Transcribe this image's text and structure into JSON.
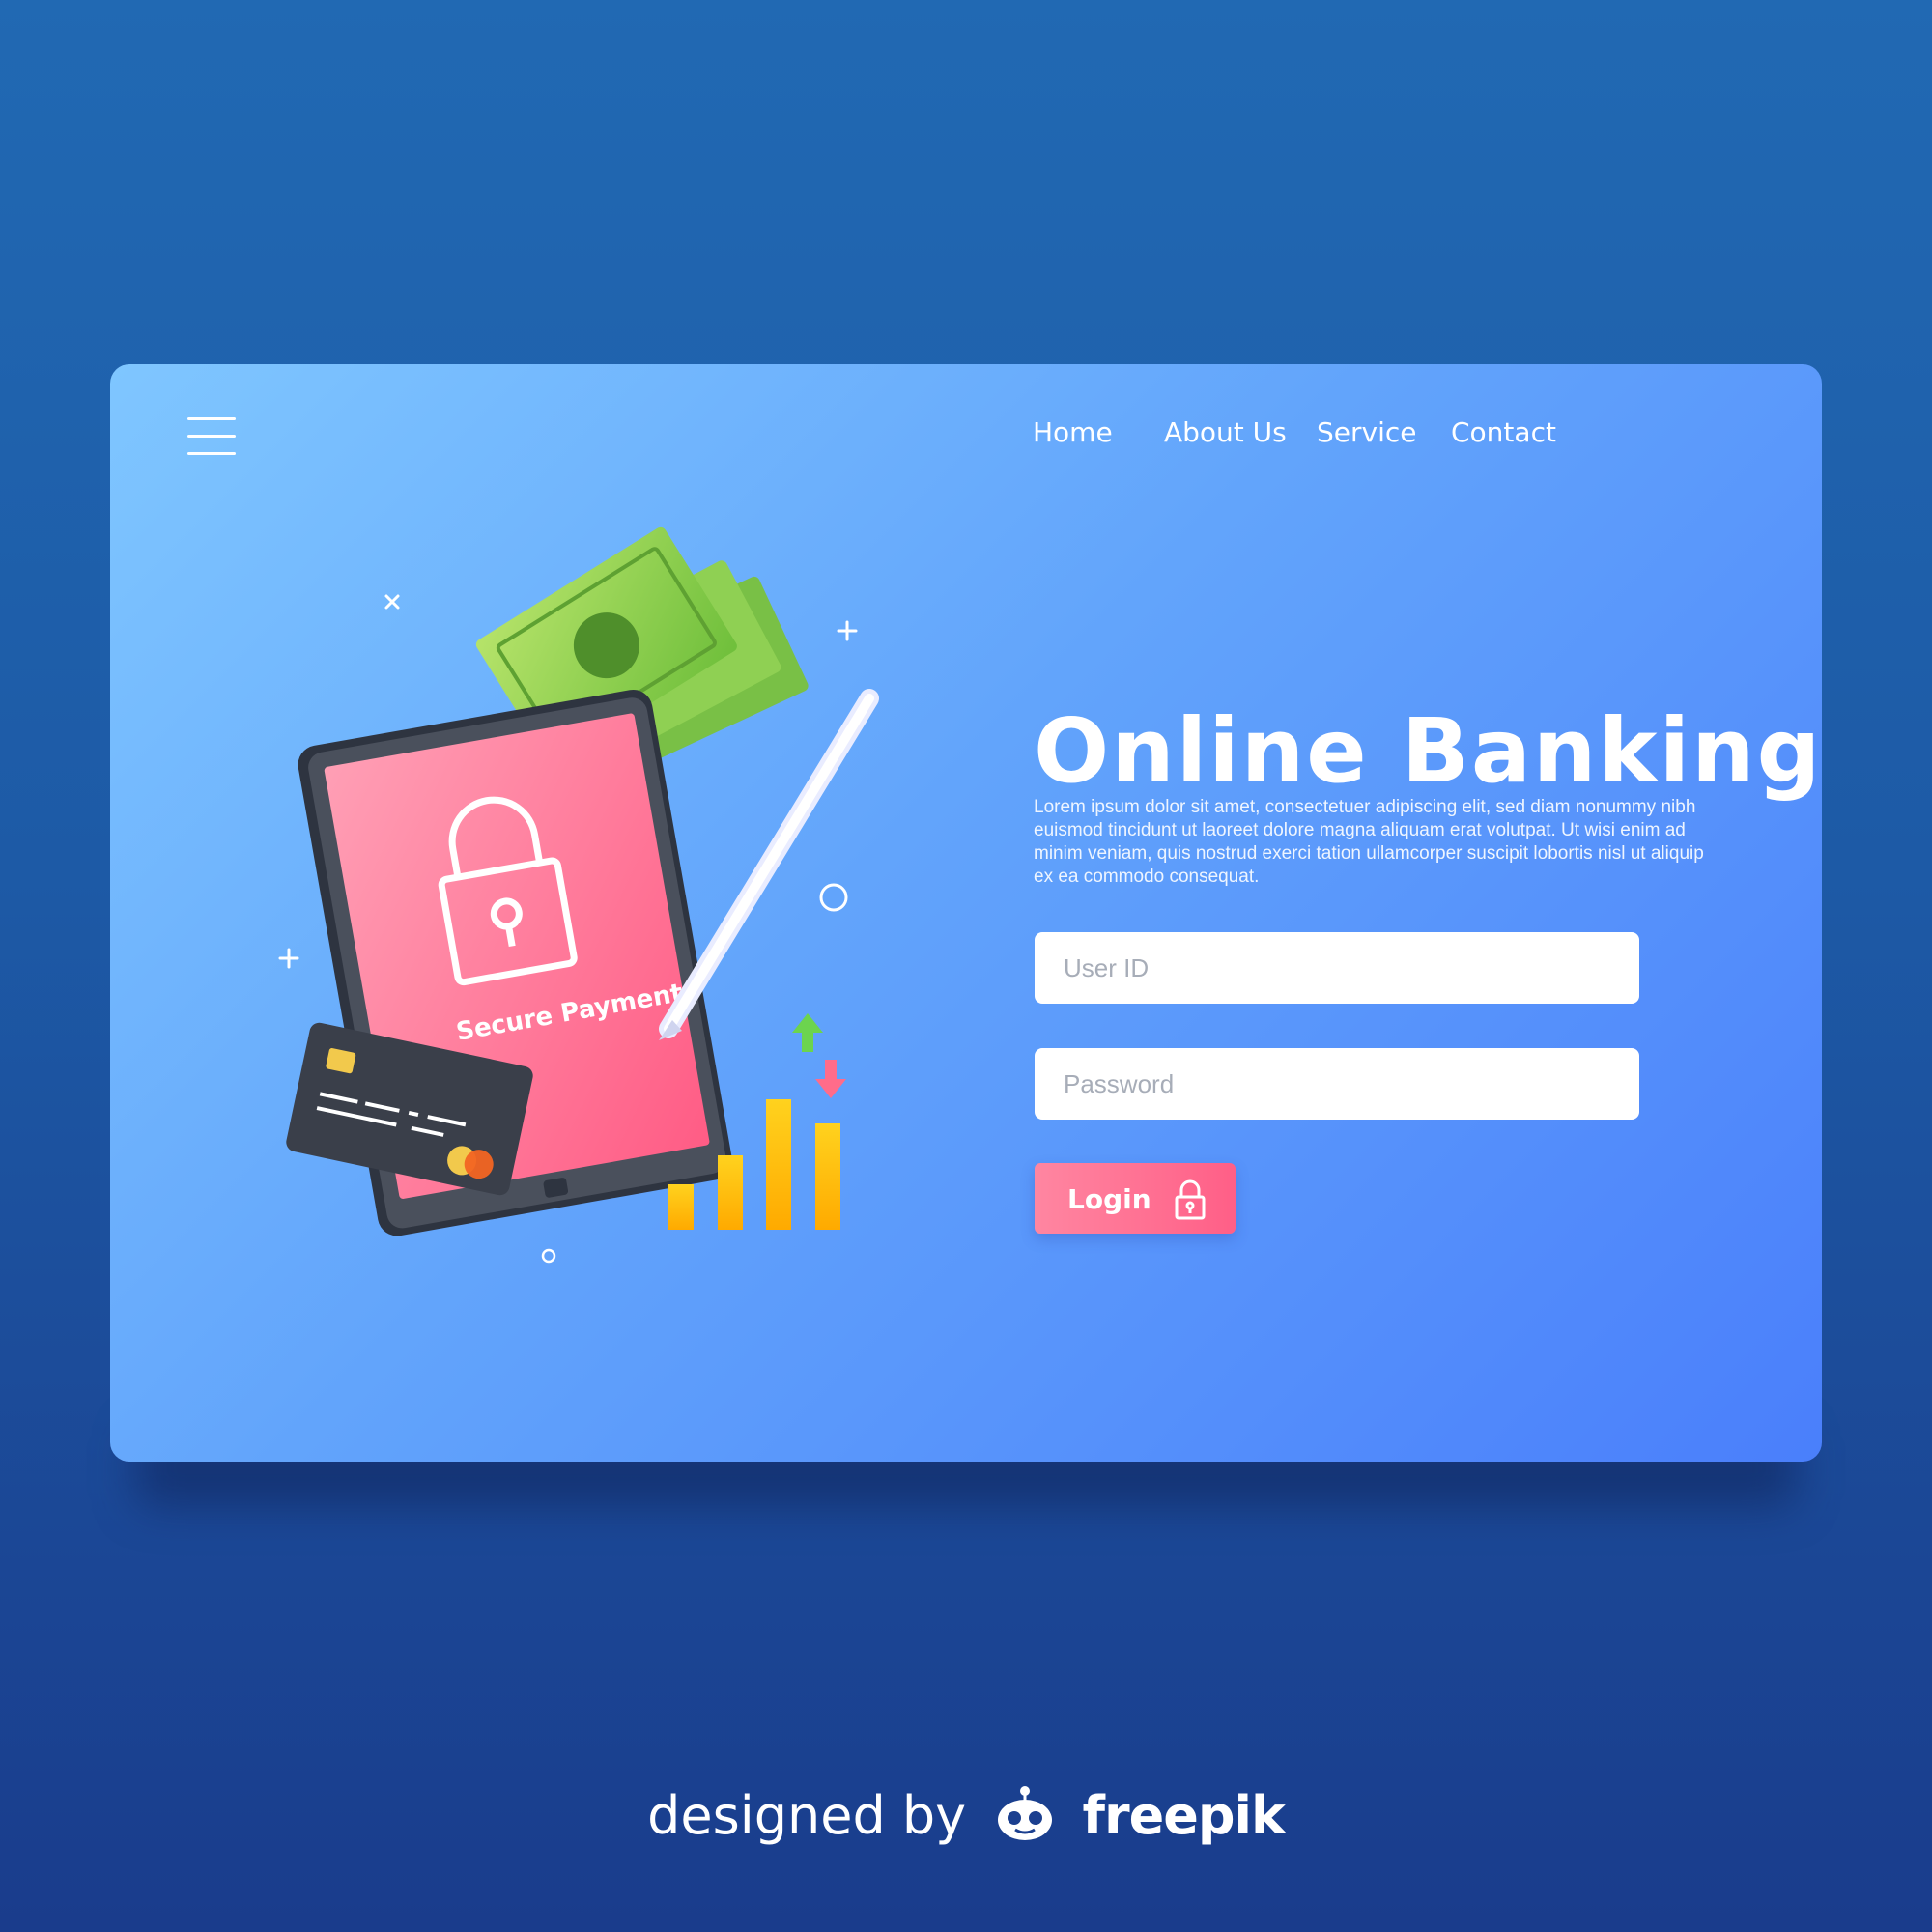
{
  "nav": {
    "items": [
      "Home",
      "About Us",
      "Service",
      "Contact"
    ]
  },
  "hero": {
    "title": "Online Banking",
    "description": "Lorem ipsum dolor sit amet, consectetuer adipiscing elit, sed diam nonummy nibh euismod tincidunt ut laoreet dolore magna aliquam erat volutpat. Ut wisi enim ad minim veniam, quis nostrud exerci tation ullamcorper suscipit lobortis nisl ut aliquip ex ea commodo consequat."
  },
  "form": {
    "user_id_placeholder": "User ID",
    "user_id_value": "",
    "password_placeholder": "Password",
    "password_value": "",
    "login_label": "Login"
  },
  "illustration": {
    "tablet_caption": "Secure Payment"
  },
  "footer": {
    "prefix": "designed by",
    "brand": "freepik"
  },
  "colors": {
    "accent_pink": "#ff5f87",
    "card_light": "#7fc6ff",
    "card_dark": "#4a7ffb",
    "background": "#1d5aa6"
  },
  "icons": [
    "menu-icon",
    "lock-icon",
    "freepik-logo-icon"
  ]
}
